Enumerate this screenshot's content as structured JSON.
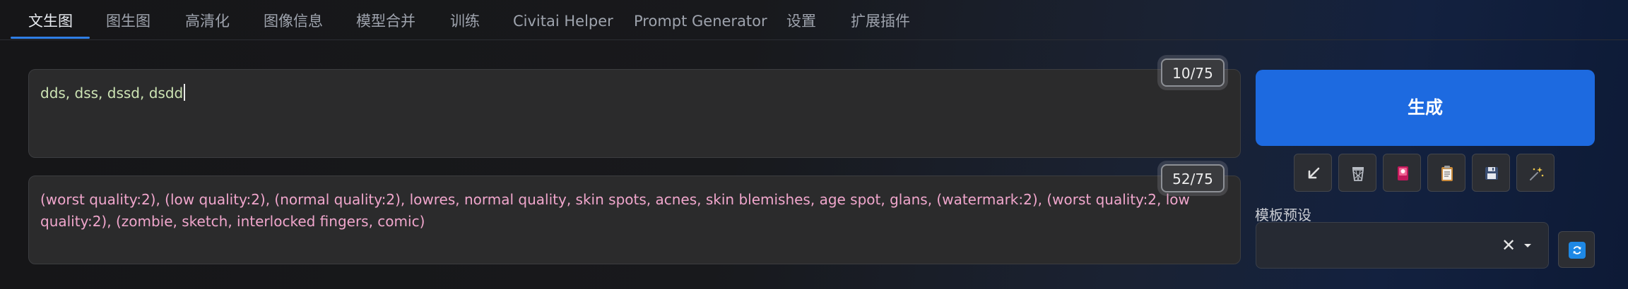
{
  "tabs": [
    {
      "label": "文生图"
    },
    {
      "label": "图生图"
    },
    {
      "label": "高清化"
    },
    {
      "label": "图像信息"
    },
    {
      "label": "模型合并"
    },
    {
      "label": "训练"
    },
    {
      "label": "Civitai Helper"
    },
    {
      "label": "Prompt Generator"
    },
    {
      "label": "设置"
    },
    {
      "label": "扩展插件"
    }
  ],
  "active_tab": "文生图",
  "prompt": {
    "value": "dds, dss, dssd, dsdd",
    "token_count": "10/75"
  },
  "negative_prompt": {
    "value": "(worst quality:2), (low quality:2), (normal quality:2), lowres, normal quality, skin spots, acnes, skin blemishes, age spot, glans, (watermark:2), (worst quality:2, low quality:2), (zombie, sketch, interlocked fingers, comic)",
    "token_count": "52/75"
  },
  "generate_button": {
    "label": "生成"
  },
  "tool_buttons": [
    {
      "icon": "arrow-down-left-icon"
    },
    {
      "icon": "trash-icon"
    },
    {
      "icon": "pink-card-icon"
    },
    {
      "icon": "clipboard-icon"
    },
    {
      "icon": "floppy-disk-icon"
    },
    {
      "icon": "magic-wand-icon"
    }
  ],
  "styles": {
    "label": "模板预设",
    "selected": "",
    "clear_symbol": "✕"
  },
  "colors": {
    "accent": "#1d6ae0",
    "prompt_text": "#cde4b4",
    "negative_text": "#f0a6cc",
    "tab_active": "#e9ecf1",
    "tab_inactive": "#9ea3ad"
  }
}
